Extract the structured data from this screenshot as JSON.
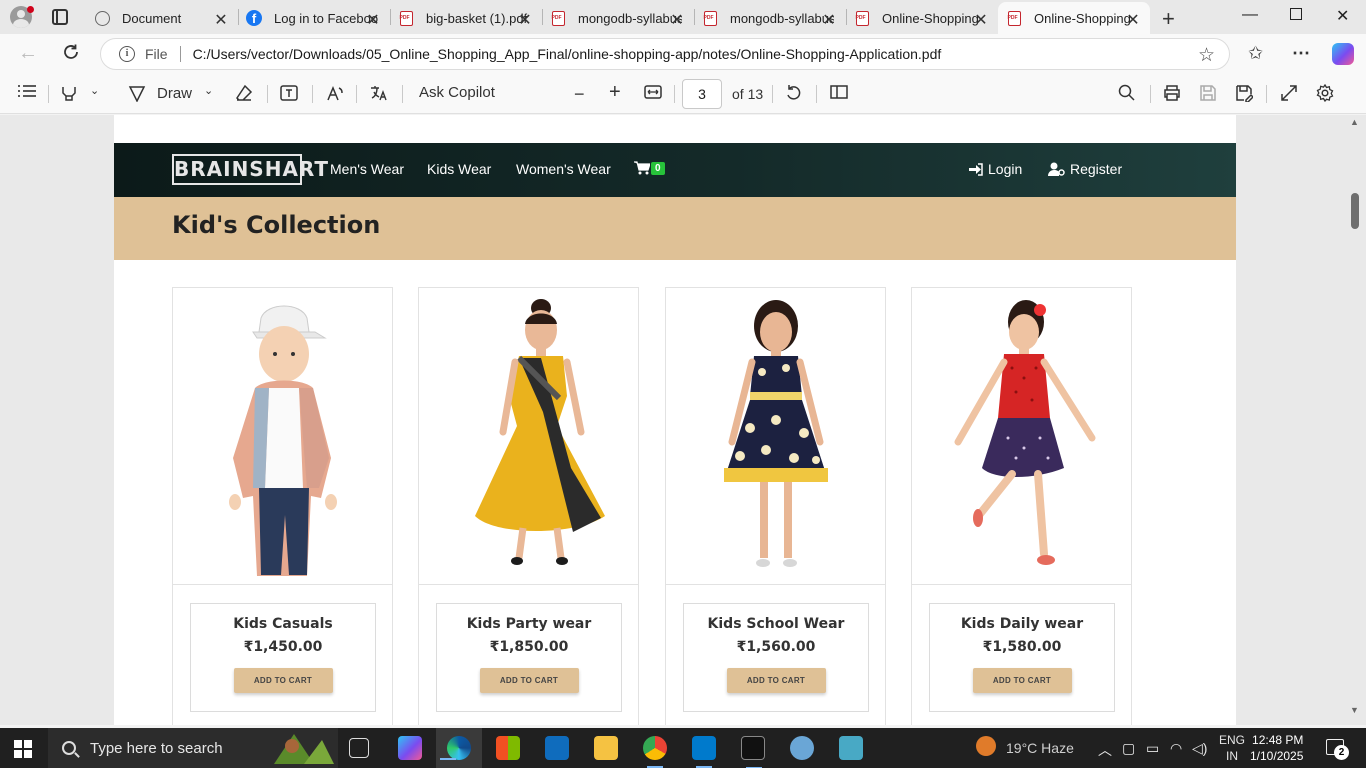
{
  "browser": {
    "tabs": [
      {
        "title": "Document",
        "favicon": "globe-icon"
      },
      {
        "title": "Log in to Facebook",
        "favicon": "facebook-icon"
      },
      {
        "title": "big-basket (1).pdf",
        "favicon": "pdf-icon"
      },
      {
        "title": "mongodb-syllabus",
        "favicon": "pdf-icon"
      },
      {
        "title": "mongodb-syllabus",
        "favicon": "pdf-icon"
      },
      {
        "title": "Online-Shopping",
        "favicon": "pdf-icon"
      },
      {
        "title": "Online-Shopping",
        "favicon": "pdf-icon",
        "active": true
      }
    ],
    "address": {
      "scheme_label": "File",
      "url": "C:/Users/vector/Downloads/05_Online_Shopping_App_Final/online-shopping-app/notes/Online-Shopping-Application.pdf"
    }
  },
  "pdf_toolbar": {
    "draw_label": "Draw",
    "ask_copilot_label": "Ask Copilot",
    "page_current": "3",
    "page_total_label": "of 13"
  },
  "site": {
    "logo": "BRAINSHART",
    "nav": [
      "Men's Wear",
      "Kids Wear",
      "Women's Wear"
    ],
    "cart_count": "0",
    "login_label": "Login",
    "register_label": "Register",
    "collection_title": "Kid's Collection",
    "products": [
      {
        "name": "Kids Casuals",
        "price": "₹1,450.00",
        "button": "ADD TO CART"
      },
      {
        "name": "Kids Party wear",
        "price": "₹1,850.00",
        "button": "ADD TO CART"
      },
      {
        "name": "Kids School Wear",
        "price": "₹1,560.00",
        "button": "ADD TO CART"
      },
      {
        "name": "Kids Daily wear",
        "price": "₹1,580.00",
        "button": "ADD TO CART"
      }
    ],
    "colors": {
      "header_dark": "#0c1a19",
      "band": "#dfc196",
      "badge": "#27c23a"
    }
  },
  "taskbar": {
    "search_placeholder": "Type here to search",
    "weather": "19°C  Haze",
    "lang_top": "ENG",
    "lang_bottom": "IN",
    "time": "12:48 PM",
    "date": "1/10/2025",
    "notifications": "2"
  }
}
